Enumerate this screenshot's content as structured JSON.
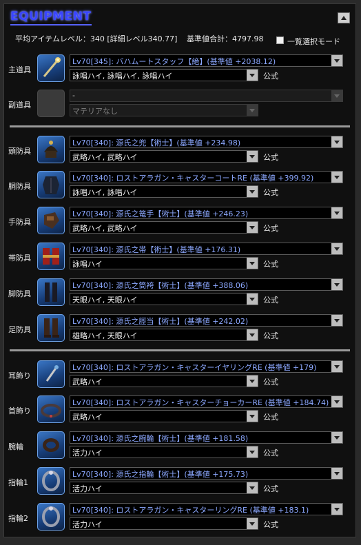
{
  "header": {
    "title": "EQUIPMENT",
    "avg_item_level": "平均アイテムレベル：340 [詳細レベル340.77]",
    "base_total": "基準値合計：4797.98",
    "bulk_mode_label": "一覧選択モード"
  },
  "official_label": "公式",
  "slots": [
    {
      "label": "主道具",
      "icon": "staff-icon",
      "item": "Lv70[345]: バハムートスタッフ【絶】(基準値 +2038.12)",
      "materia": "詠唱ハイ, 詠唱ハイ, 詠唱ハイ",
      "official": "公式"
    },
    {
      "label": "副道具",
      "icon": "empty-slot-icon",
      "item": "-",
      "materia": "マテリアなし",
      "official": ""
    },
    {
      "label": "頭防具",
      "icon": "helmet-icon",
      "item": "Lv70[340]: 源氏之兜【術士】(基準値 +234.98)",
      "materia": "武略ハイ, 武略ハイ",
      "official": "公式"
    },
    {
      "label": "胴防具",
      "icon": "body-armor-icon",
      "item": "Lv70[340]: ロストアラガン・キャスターコートRE (基準値 +399.92)",
      "materia": "詠唱ハイ, 詠唱ハイ",
      "official": "公式"
    },
    {
      "label": "手防具",
      "icon": "gauntlet-icon",
      "item": "Lv70[340]: 源氏之篭手【術士】(基準値 +246.23)",
      "materia": "武略ハイ, 武略ハイ",
      "official": "公式"
    },
    {
      "label": "帯防具",
      "icon": "belt-icon",
      "item": "Lv70[340]: 源氏之帯【術士】(基準値 +176.31)",
      "materia": "詠唱ハイ",
      "official": "公式"
    },
    {
      "label": "脚防具",
      "icon": "legs-icon",
      "item": "Lv70[340]: 源氏之筒袴【術士】(基準値 +388.06)",
      "materia": "天眼ハイ, 天眼ハイ",
      "official": "公式"
    },
    {
      "label": "足防具",
      "icon": "boots-icon",
      "item": "Lv70[340]: 源氏之脛当【術士】(基準値 +242.02)",
      "materia": "雄略ハイ, 天眼ハイ",
      "official": "公式"
    },
    {
      "label": "耳飾り",
      "icon": "earring-icon",
      "item": "Lv70[340]: ロストアラガン・キャスターイヤリングRE (基準値 +179)",
      "materia": "武略ハイ",
      "official": "公式"
    },
    {
      "label": "首飾り",
      "icon": "necklace-icon",
      "item": "Lv70[340]: ロストアラガン・キャスターチョーカーRE (基準値 +184.74)",
      "materia": "武略ハイ",
      "official": "公式"
    },
    {
      "label": "腕輪",
      "icon": "bracelet-icon",
      "item": "Lv70[340]: 源氏之腕輪【術士】(基準値 +181.58)",
      "materia": "活力ハイ",
      "official": "公式"
    },
    {
      "label": "指輪1",
      "icon": "ring-icon",
      "item": "Lv70[340]: 源氏之指輪【術士】(基準値 +175.73)",
      "materia": "活力ハイ",
      "official": "公式"
    },
    {
      "label": "指輪2",
      "icon": "ring-icon",
      "item": "Lv70[340]: ロストアラガン・キャスターリングRE (基準値 +183.1)",
      "materia": "活力ハイ",
      "official": "公式"
    }
  ]
}
